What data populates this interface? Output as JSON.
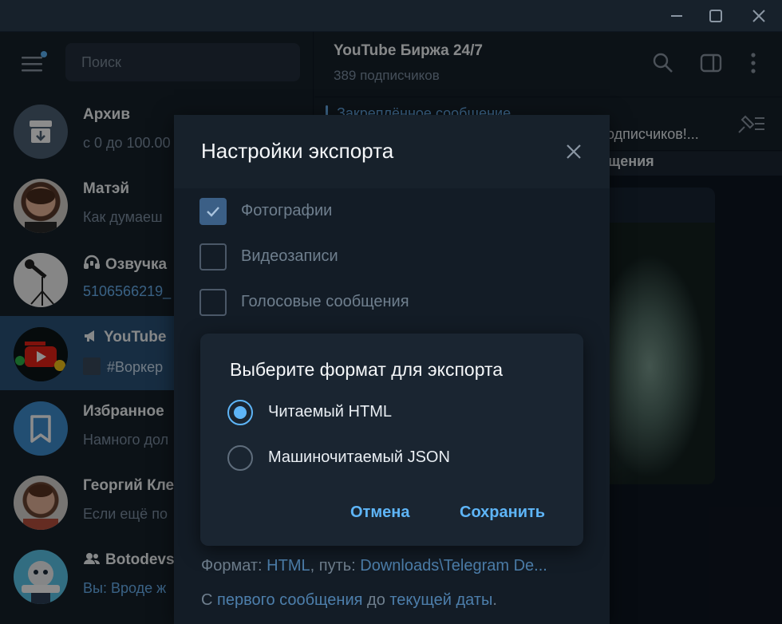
{
  "window": {
    "controls": [
      "minimize-icon",
      "maximize-icon",
      "close-icon"
    ]
  },
  "sidebar": {
    "search_placeholder": "Поиск",
    "chats": [
      {
        "name": "Архив",
        "preview": "с 0 до 100.00"
      },
      {
        "name": "Матэй",
        "preview": "Как думаеш"
      },
      {
        "name": "Озвучка",
        "preview": "5106566219_"
      },
      {
        "name": "YouTube",
        "preview": "#Воркер"
      },
      {
        "name": "Избранное",
        "preview": "Намного дол"
      },
      {
        "name": "Георгий Кле",
        "preview": "Если ещё по"
      },
      {
        "name": "Botodevs",
        "preview": "Вы: Вроде ж"
      }
    ]
  },
  "channel": {
    "title": "YouTube Биржа 24/7",
    "subscribers": "389 подписчиков",
    "pinned_label": "Закреплённое сообщение",
    "pinned_text": "одписчиков!...",
    "strip_text": "щения",
    "image_text": "?"
  },
  "export_dialog": {
    "title": "Настройки экспорта",
    "options": [
      {
        "label": "Фотографии",
        "checked": true
      },
      {
        "label": "Видеозаписи",
        "checked": false
      },
      {
        "label": "Голосовые сообщения",
        "checked": false
      }
    ],
    "format_prefix": "Формат: ",
    "format_value": "HTML",
    "path_prefix": ", путь: ",
    "path_value": "Downloads\\Telegram De...",
    "range_prefix": "С ",
    "range_from": "первого сообщения",
    "range_mid": " до ",
    "range_to": "текущей даты",
    "range_suffix": "."
  },
  "format_dialog": {
    "title": "Выберите формат для экспорта",
    "options": [
      {
        "label": "Читаемый HTML",
        "selected": true
      },
      {
        "label": "Машиночитаемый JSON",
        "selected": false
      }
    ],
    "cancel_label": "Отмена",
    "save_label": "Сохранить"
  },
  "colors": {
    "accent": "#5eb5f7",
    "active_chat": "#2b5278",
    "background": "#17212b"
  }
}
